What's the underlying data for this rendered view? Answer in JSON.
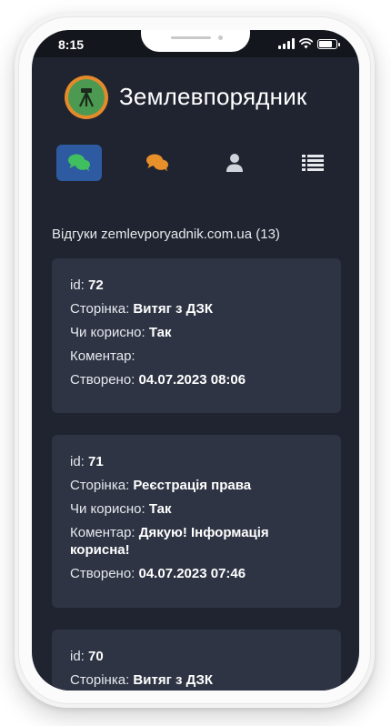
{
  "status_bar": {
    "time": "8:15"
  },
  "header": {
    "title": "Землевпорядник"
  },
  "tabs": [
    {
      "icon": "chat-bubbles-icon",
      "active": true,
      "color": "#3fbf5f"
    },
    {
      "icon": "comments-icon",
      "active": false,
      "color": "#e8902a"
    },
    {
      "icon": "user-icon",
      "active": false,
      "color": "#cfd3da"
    },
    {
      "icon": "list-icon",
      "active": false,
      "color": "#e6e8ec"
    }
  ],
  "section": {
    "title": "Відгуки zemlevporyadnik.com.ua (13)"
  },
  "labels": {
    "id": "id:",
    "page": "Сторінка:",
    "useful": "Чи корисно:",
    "comment": "Коментар:",
    "created": "Створено:"
  },
  "reviews": [
    {
      "id": "72",
      "page": "Витяг з ДЗК",
      "useful": "Так",
      "comment": "",
      "created": "04.07.2023 08:06"
    },
    {
      "id": "71",
      "page": "Реєстрація права",
      "useful": "Так",
      "comment": "Дякую! Інформація корисна!",
      "created": "04.07.2023 07:46"
    },
    {
      "id": "70",
      "page": "Витяг з ДЗК",
      "useful": "",
      "comment": "",
      "created": ""
    }
  ],
  "colors": {
    "background": "#1f2430",
    "card": "#2e3444",
    "accent": "#2d5aa0"
  }
}
